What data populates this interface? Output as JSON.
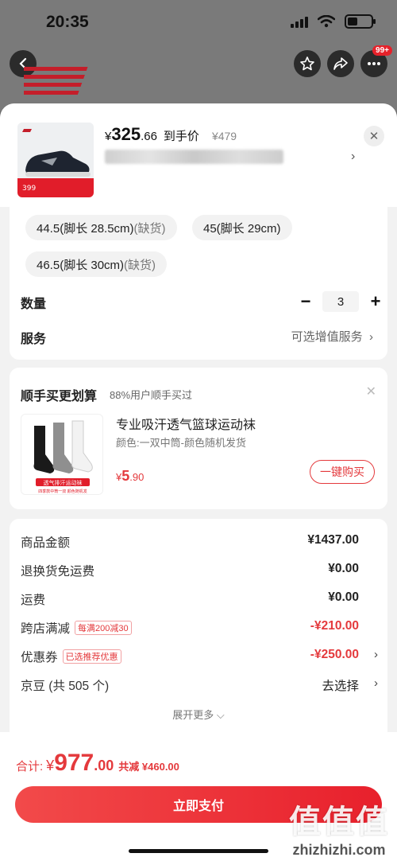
{
  "status_bar": {
    "time": "20:35"
  },
  "nav": {
    "badge": "99+"
  },
  "product": {
    "currency": "¥",
    "price_int": "325",
    "price_dec": ".66",
    "price_tag": "到手价",
    "original_price": "¥479",
    "thumb_price": "399"
  },
  "sizes": [
    {
      "label": "44.5(脚长 28.5cm)",
      "status": "(缺货)"
    },
    {
      "label": "45(脚长 29cm)",
      "status": ""
    },
    {
      "label": "46.5(脚长 30cm)",
      "status": "(缺货)"
    }
  ],
  "quantity": {
    "label": "数量",
    "value": "3",
    "minus": "−",
    "plus": "+"
  },
  "service": {
    "label": "服务",
    "value": "可选增值服务",
    "chevron": "›"
  },
  "upsell": {
    "title": "顺手买更划算",
    "subtitle": "88%用户顺手买过",
    "item_name": "专业吸汗透气篮球运动袜",
    "item_spec": "颜色:一双中筒-颜色随机发货",
    "price_sym": "¥",
    "price_int": "5",
    "price_dec": ".90",
    "buy_label": "一键购买",
    "sock_caption": "透气排汗运动袜",
    "sock_caption2": "四季款中筒一双  颜色随机发"
  },
  "summary": {
    "rows": [
      {
        "label": "商品金额",
        "tag": "",
        "value": "¥1437.00",
        "red": false,
        "chevron": ""
      },
      {
        "label": "退换货免运费",
        "tag": "",
        "value": "¥0.00",
        "red": false,
        "chevron": ""
      },
      {
        "label": "运费",
        "tag": "",
        "value": "¥0.00",
        "red": false,
        "chevron": ""
      },
      {
        "label": "跨店满减",
        "tag": "每满200减30",
        "value": "-¥210.00",
        "red": true,
        "chevron": ""
      },
      {
        "label": "优惠券",
        "tag": "已选推荐优惠",
        "value": "-¥250.00",
        "red": true,
        "chevron": "›"
      },
      {
        "label": "京豆 (共 505 个)",
        "tag": "",
        "value": "去选择",
        "red": false,
        "chevron": "›"
      }
    ],
    "expand_more": "展开更多 ⌵"
  },
  "footer": {
    "total_label": "合计:",
    "total_sym": "¥",
    "total_int": "977",
    "total_dec": ".00",
    "saved": "共减 ¥460.00",
    "pay_label": "立即支付"
  },
  "watermark": {
    "big": "值值值",
    "small": "zhizhizhi.com"
  },
  "colors": {
    "accent": "#e4393c",
    "brand_red": "#d0202a"
  }
}
